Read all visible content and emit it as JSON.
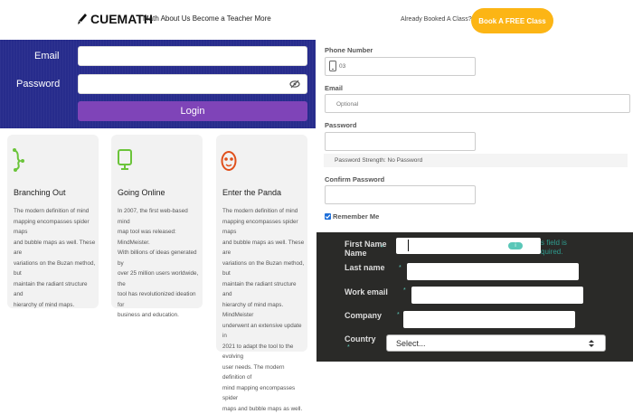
{
  "header": {
    "logo_text": "CUEMATH",
    "nav_text": "Math About Us Become a Teacher More",
    "already_booked": "Already Booked A Class?",
    "book_button": "Book A FREE Class"
  },
  "login": {
    "email_label": "Email",
    "password_label": "Password",
    "login_button": "Login"
  },
  "cards": [
    {
      "icon": "branch-icon",
      "title": "Branching Out",
      "lines": [
        "The modern definition of mind",
        "mapping encompasses spider maps",
        "and bubble maps as well. These are",
        "variations on the Buzan method, but",
        "maintain the radiant structure and",
        "hierarchy of mind maps."
      ]
    },
    {
      "icon": "monitor-icon",
      "title": "Going Online",
      "lines": [
        "In 2007, the first web-based mind",
        "map tool was released: MindMeister.",
        "With billions of ideas generated by",
        "over 25 million users worldwide, the",
        "tool has revolutionized ideation for",
        "business and education."
      ]
    },
    {
      "icon": "panda-icon",
      "title": "Enter the Panda",
      "lines": [
        "The modern definition of mind",
        "mapping encompasses spider maps",
        "and bubble maps as well. These are",
        "variations on the Buzan method, but",
        "maintain the radiant structure and",
        "hierarchy of mind maps. MindMeister",
        "underwent an extensive update in",
        "2021 to adapt the tool to the evolving",
        "user needs. The modern definition of",
        "mind mapping encompasses spider",
        "maps and bubble maps as well."
      ]
    }
  ],
  "right_form": {
    "phone_label": "Phone Number",
    "phone_value": "03",
    "email_label": "Email",
    "email_placeholder": "Optional",
    "password_label": "Password",
    "password_strength": "Password Strength: No Password",
    "confirm_label": "Confirm Password",
    "remember_label": "Remember Me"
  },
  "dark_form": {
    "first_name_label": "First Name",
    "required_mark": "*",
    "validation_text_1": "s field is",
    "validation_text_2": "quired.",
    "last_name_label": "Last name",
    "work_email_label": "Work email",
    "company_label": "Company",
    "country_label": "Country",
    "select_placeholder": "Select..."
  },
  "colors": {
    "login_bg": "#272c8c",
    "login_button": "#7f44b8",
    "book_button": "#fcb515",
    "dark_bg": "#2a2a28",
    "accent_teal": "#5ac7b8"
  }
}
